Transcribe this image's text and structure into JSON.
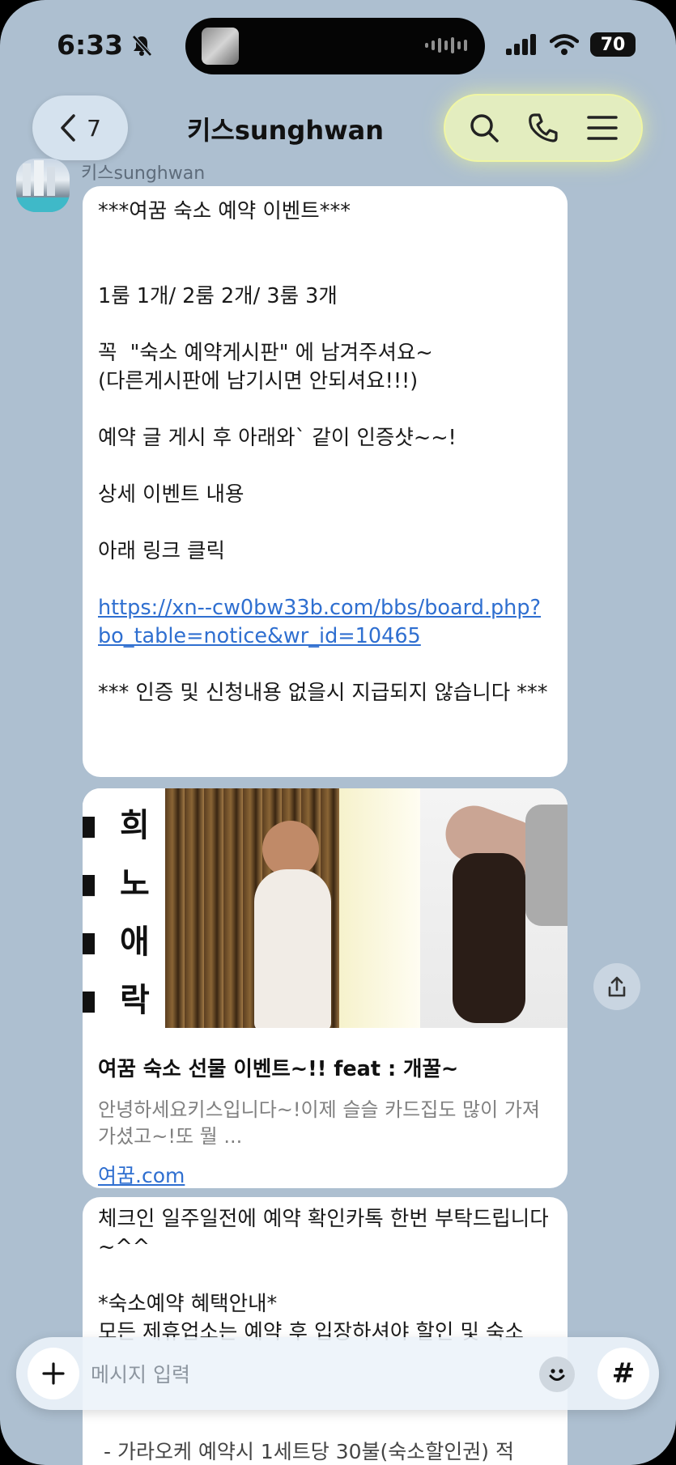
{
  "status": {
    "time": "6:33",
    "battery": "70"
  },
  "header": {
    "back_count": "7",
    "title": "키스sunghwan"
  },
  "sender": {
    "name": "키스sunghwan"
  },
  "message1": {
    "lines_before_link": "***여꿈 숙소 예약 이벤트***\n\n\n1룸 1개/ 2룸 2개/ 3룸 3개\n\n꼭  \"숙소 예약게시판\" 에 남겨주셔요~\n(다른게시판에 남기시면 안되셔요!!!)\n\n예약 글 게시 후 아래와` 같이 인증샷~~!\n\n상세 이벤트 내용\n\n아래 링크 클릭\n\n",
    "link": "https://xn--cw0bw33b.com/bbs/board.php?bo_table=notice&wr_id=10465",
    "lines_after_link": "\n\n*** 인증 및 신청내용 없을시 지급되지 않습니다 ***"
  },
  "link_card": {
    "image_text": [
      "희",
      "노",
      "애",
      "락"
    ],
    "title": "여꿈 숙소 선물 이벤트~!! feat : 개꿀~",
    "description": "안녕하세요키스입니다~!이제 슬슬 카드집도 많이 가져가셨고~!또 뭘 ...",
    "domain": "여꿈.com"
  },
  "message2": {
    "text": "체크인 일주일전에 예약 확인카톡 한번 부탁드립니다~^^\n\n*숙소예약 혜택안내*\n모든 제휴업소는 예약 후 입장하셔야 할인 및 숙소"
  },
  "input": {
    "placeholder": "메시지 입력",
    "hash": "#"
  },
  "bottom_partial_text": "- 가라오케 예약시 1세트당 30불(숙소할인권) 적"
}
